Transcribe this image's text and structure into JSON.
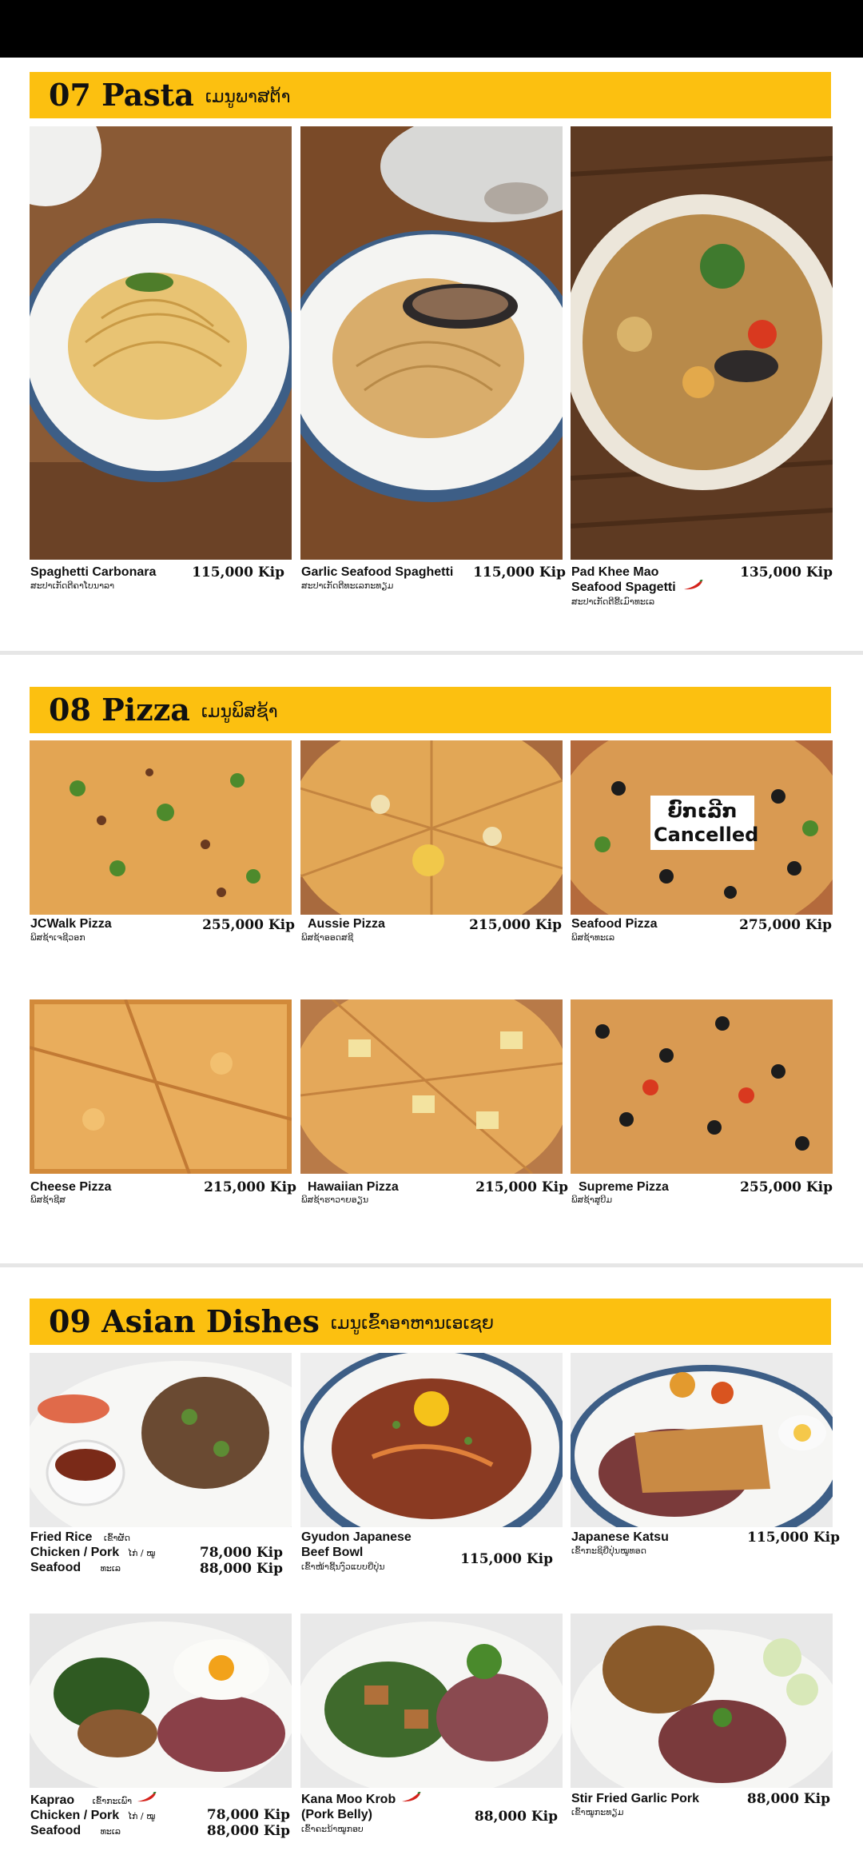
{
  "sections": [
    {
      "number_title": "07 Pasta",
      "lao_title": "ເມນູພາສຕ້າ",
      "items": [
        {
          "name": "Spaghetti Carbonara",
          "lao": "ສະປາເກັດຕີຄາໂບນາລາ",
          "price": "115,000 Kip"
        },
        {
          "name": "Garlic Seafood Spaghetti",
          "lao": "ສະປາເກັດຕີທະເລກະທຽມ",
          "price": "115,000 Kip"
        },
        {
          "name_line1": "Pad Khee Mao",
          "name_line2": "Seafood Spagetti",
          "lao": "ສະປາເກັດຕີຂີ້ເມົາທະເລ",
          "price": "135,000 Kip",
          "spicy": true
        }
      ]
    },
    {
      "number_title": "08 Pizza",
      "lao_title": "ເມນູພິສຊ້າ",
      "items": [
        {
          "name": "JCWalk Pizza",
          "lao": "ພິສຊ້າເຈຊີວອກ",
          "price": "255,000 Kip"
        },
        {
          "name": "Aussie Pizza",
          "lao": "ພິສຊ້າອອດສຊີ",
          "price": "215,000 Kip"
        },
        {
          "name": "Seafood Pizza",
          "lao": "ພິສຊ້າທະເລ",
          "price": "275,000 Kip",
          "cancel_lao": "ຍົກເລີກ",
          "cancel_en": "Cancelled"
        },
        {
          "name": "Cheese Pizza",
          "lao": "ພິສຊ້າຊີສ",
          "price": "215,000 Kip"
        },
        {
          "name": "Hawaiian Pizza",
          "lao": "ພິສຊ້າຮາວາຍອຽນ",
          "price": "215,000 Kip"
        },
        {
          "name": "Supreme Pizza",
          "lao": "ພິສຊ້າສູບີມ",
          "price": "255,000 Kip"
        }
      ]
    },
    {
      "number_title": "09 Asian Dishes",
      "lao_title": "ເມນູເຂົ້າອາຫານເອເຊຍ",
      "items": [
        {
          "name": "Fried Rice",
          "name_lao": "ເຂົ້າຜັດ",
          "opt1": "Chicken / Pork",
          "opt1_lao": "ໄກ່ / ໝູ",
          "opt2": "Seafood",
          "opt2_lao": "ທະເລ",
          "price1": "78,000 Kip",
          "price2": "88,000 Kip"
        },
        {
          "name_line1": "Gyudon Japanese",
          "name_line2": "Beef Bowl",
          "lao": "ເຂົ້າໜ້າຊີ້ນງົວແບບຍີ່ປຸ່ນ",
          "price": "115,000 Kip"
        },
        {
          "name": "Japanese Katsu",
          "lao": "ເຂົ້າກະຊິຍີ່ປຸ່ນໝູທອດ",
          "price": "115,000 Kip"
        },
        {
          "name": "Kaprao",
          "name_lao": "ເຂົ້າກະເພົາ",
          "opt1": "Chicken / Pork",
          "opt1_lao": "ໄກ່ / ໝູ",
          "opt2": "Seafood",
          "opt2_lao": "ທະເລ",
          "price1": "78,000 Kip",
          "price2": "88,000 Kip",
          "spicy": true
        },
        {
          "name_line1": "Kana Moo Krob",
          "name_line2": "(Pork Belly)",
          "lao": "ເຂົ້າຄະນ້າໝູກອບ",
          "price": "88,000 Kip",
          "spicy": true
        },
        {
          "name": "Stir Fried Garlic Pork",
          "lao": "ເຂົ້າໝູກະທຽມ",
          "price": "88,000 Kip"
        }
      ]
    }
  ],
  "colors": {
    "band": "#fcc010",
    "topbar": "#000000",
    "chili": "#d4221b"
  }
}
